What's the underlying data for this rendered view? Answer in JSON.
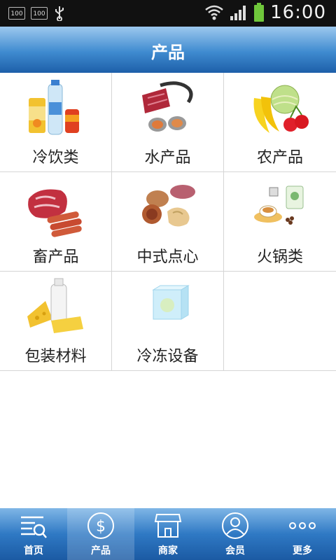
{
  "status_bar": {
    "badges": [
      "100",
      "100"
    ],
    "time": "16:00",
    "icons": [
      "usb-icon",
      "wifi-icon",
      "signal-icon",
      "battery-icon"
    ]
  },
  "header": {
    "title": "产品"
  },
  "categories": [
    {
      "label": "冷饮类",
      "icon": "cold-drinks-icon"
    },
    {
      "label": "水产品",
      "icon": "seafood-icon"
    },
    {
      "label": "农产品",
      "icon": "farm-produce-icon"
    },
    {
      "label": "畜产品",
      "icon": "livestock-icon"
    },
    {
      "label": "中式点心",
      "icon": "chinese-snacks-icon"
    },
    {
      "label": "火锅类",
      "icon": "hotpot-icon"
    },
    {
      "label": "包装材料",
      "icon": "packaging-icon"
    },
    {
      "label": "冷冻设备",
      "icon": "freezer-icon"
    }
  ],
  "tabbar": {
    "items": [
      {
        "label": "首页",
        "icon": "home-icon"
      },
      {
        "label": "产品",
        "icon": "dollar-icon"
      },
      {
        "label": "商家",
        "icon": "store-icon"
      },
      {
        "label": "会员",
        "icon": "user-icon"
      },
      {
        "label": "更多",
        "icon": "more-icon"
      }
    ],
    "active_index": 1
  },
  "colors": {
    "header": "#3f8bd0",
    "tabbar": "#2f79c4",
    "text": "#222222"
  }
}
